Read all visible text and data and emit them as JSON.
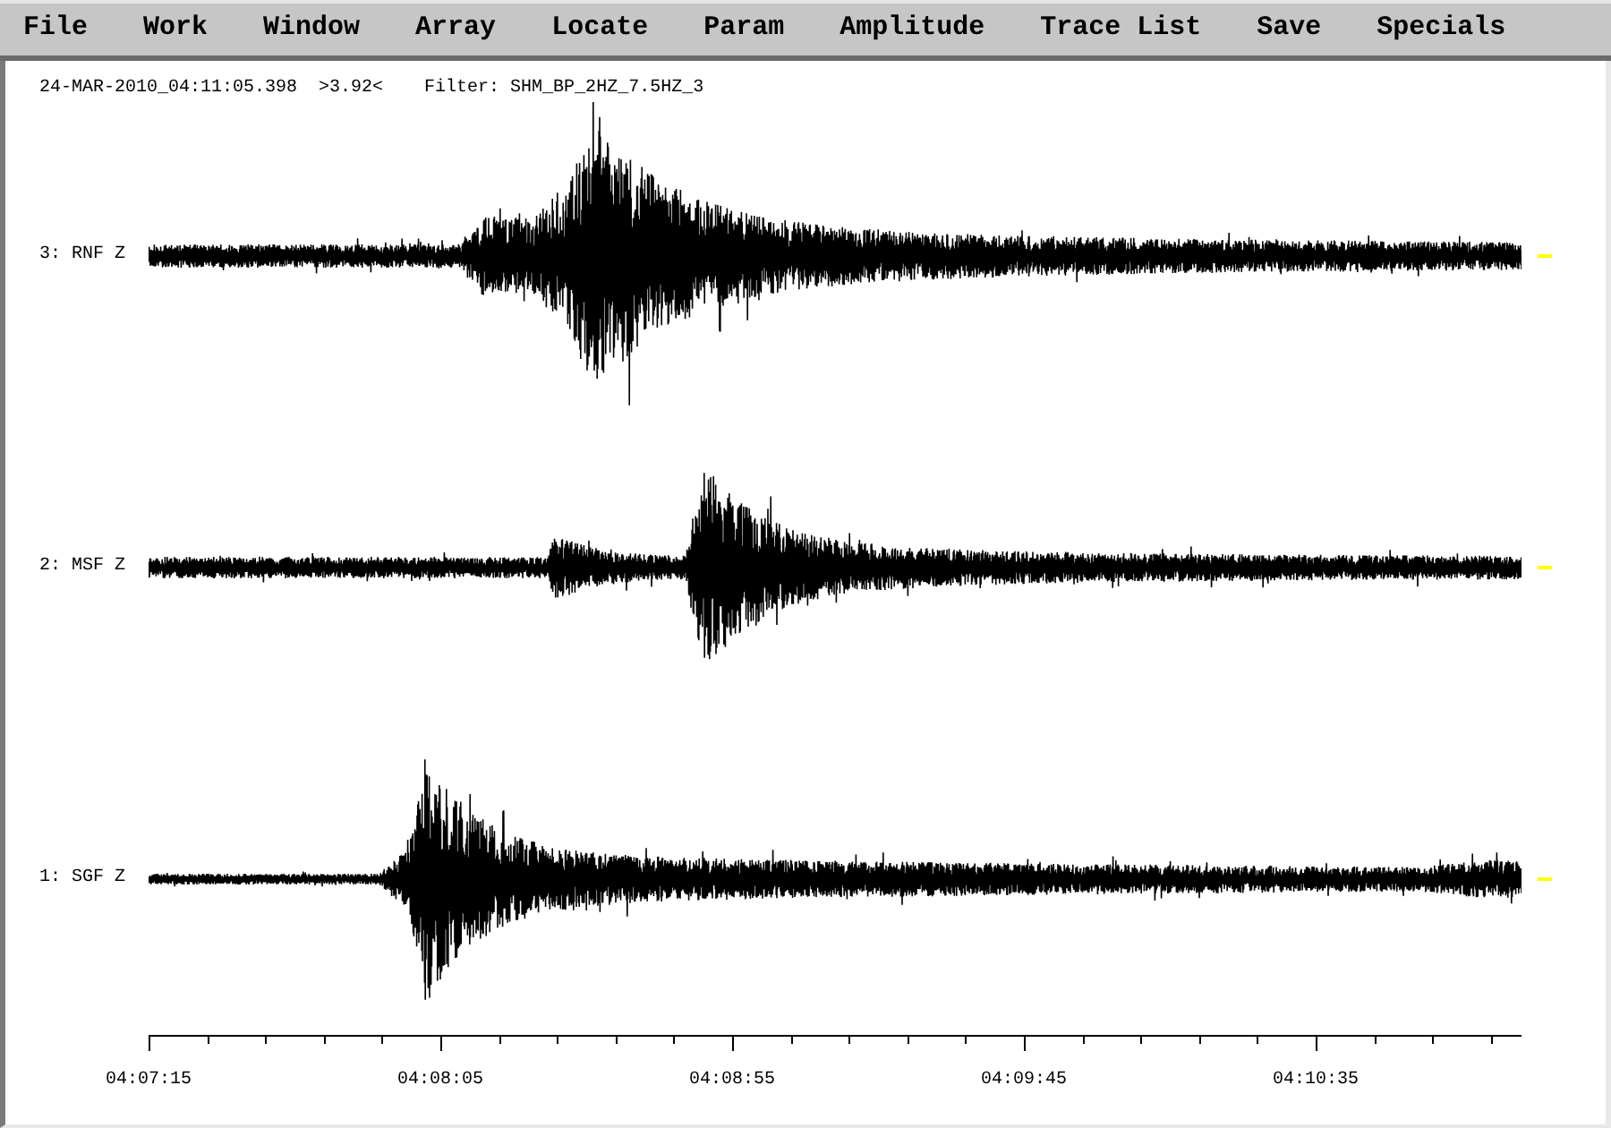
{
  "menu_bar": {
    "items": [
      "File",
      "Work",
      "Window",
      "Array",
      "Locate",
      "Param",
      "Amplitude",
      "Trace List",
      "Save",
      "Specials"
    ]
  },
  "header": {
    "timestamp": "24-MAR-2010_04:11:05.398",
    "amplitude": ">3.92<",
    "filter": "Filter: SHM_BP_2HZ_7.5HZ_3"
  },
  "traces": [
    {
      "label": "3: RNF Z"
    },
    {
      "label": "2: MSF Z"
    },
    {
      "label": "1: SGF Z"
    }
  ],
  "time_axis": {
    "labels": [
      "04:07:15",
      "04:08:05",
      "04:08:55",
      "04:09:45",
      "04:10:35"
    ]
  }
}
